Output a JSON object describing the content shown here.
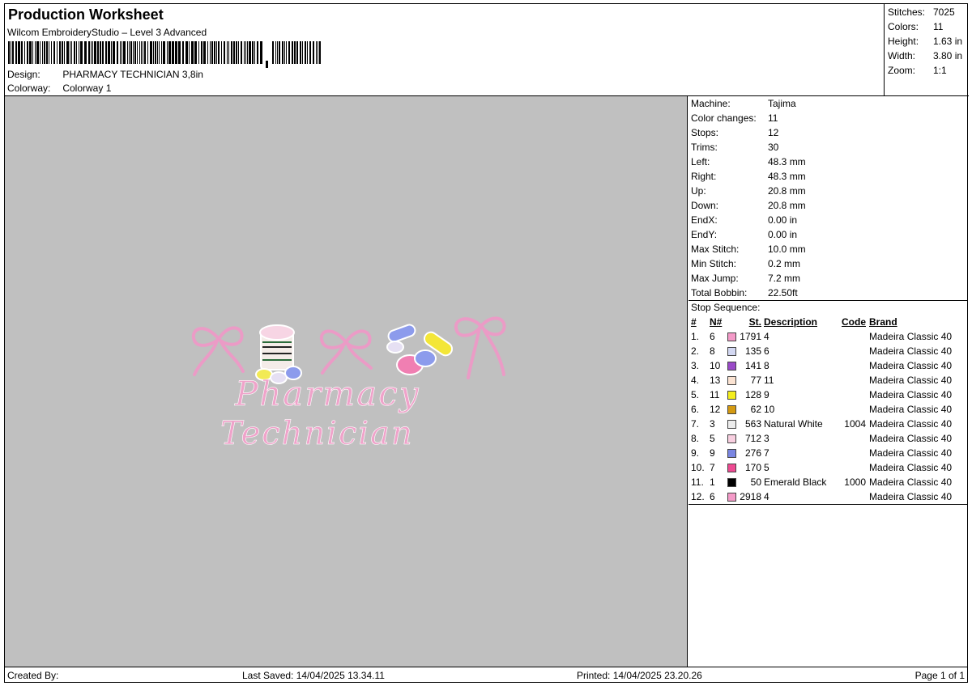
{
  "header": {
    "title": "Production Worksheet",
    "software": "Wilcom EmbroideryStudio – Level 3 Advanced",
    "design_label": "Design:",
    "design_value": "PHARMACY TECHNICIAN 3,8in",
    "colorway_label": "Colorway:",
    "colorway_value": "Colorway 1"
  },
  "stats": [
    {
      "label": "Stitches:",
      "value": "7025"
    },
    {
      "label": "Colors:",
      "value": "11"
    },
    {
      "label": "Height:",
      "value": "1.63 in"
    },
    {
      "label": "Width:",
      "value": "3.80 in"
    },
    {
      "label": "Zoom:",
      "value": "1:1"
    }
  ],
  "specs": [
    {
      "label": "Machine:",
      "value": "Tajima"
    },
    {
      "label": "Color changes:",
      "value": "11"
    },
    {
      "label": "Stops:",
      "value": "12"
    },
    {
      "label": "Trims:",
      "value": "30"
    },
    {
      "label": "Left:",
      "value": "48.3 mm"
    },
    {
      "label": "Right:",
      "value": "48.3 mm"
    },
    {
      "label": "Up:",
      "value": "20.8 mm"
    },
    {
      "label": "Down:",
      "value": "20.8 mm"
    },
    {
      "label": "EndX:",
      "value": "0.00 in"
    },
    {
      "label": "EndY:",
      "value": "0.00 in"
    },
    {
      "label": "Max Stitch:",
      "value": "10.0 mm"
    },
    {
      "label": "Min Stitch:",
      "value": "0.2 mm"
    },
    {
      "label": "Max Jump:",
      "value": "7.2 mm"
    },
    {
      "label": "Total Bobbin:",
      "value": "22.50ft"
    }
  ],
  "stop_sequence": {
    "title": "Stop Sequence:",
    "headers": {
      "idx": "#",
      "n": "N#",
      "st": "St.",
      "desc": "Description",
      "code": "Code",
      "brand": "Brand"
    },
    "rows": [
      {
        "idx": "1.",
        "n": "6",
        "color": "#f49ac8",
        "st": "1791",
        "desc": "4",
        "code": "",
        "brand": "Madeira Classic 40"
      },
      {
        "idx": "2.",
        "n": "8",
        "color": "#d3d8f2",
        "st": "135",
        "desc": "6",
        "code": "",
        "brand": "Madeira Classic 40"
      },
      {
        "idx": "3.",
        "n": "10",
        "color": "#9a4ac8",
        "st": "141",
        "desc": "8",
        "code": "",
        "brand": "Madeira Classic 40"
      },
      {
        "idx": "4.",
        "n": "13",
        "color": "#fbe3d2",
        "st": "77",
        "desc": "11",
        "code": "",
        "brand": "Madeira Classic 40"
      },
      {
        "idx": "5.",
        "n": "11",
        "color": "#f4ee1e",
        "st": "128",
        "desc": "9",
        "code": "",
        "brand": "Madeira Classic 40"
      },
      {
        "idx": "6.",
        "n": "12",
        "color": "#d49a12",
        "st": "62",
        "desc": "10",
        "code": "",
        "brand": "Madeira Classic 40"
      },
      {
        "idx": "7.",
        "n": "3",
        "color": "#ececec",
        "st": "563",
        "desc": "Natural White",
        "code": "1004",
        "brand": "Madeira Classic 40"
      },
      {
        "idx": "8.",
        "n": "5",
        "color": "#f8cfe0",
        "st": "712",
        "desc": "3",
        "code": "",
        "brand": "Madeira Classic 40"
      },
      {
        "idx": "9.",
        "n": "9",
        "color": "#7a86e2",
        "st": "276",
        "desc": "7",
        "code": "",
        "brand": "Madeira Classic 40"
      },
      {
        "idx": "10.",
        "n": "7",
        "color": "#ee4a92",
        "st": "170",
        "desc": "5",
        "code": "",
        "brand": "Madeira Classic 40"
      },
      {
        "idx": "11.",
        "n": "1",
        "color": "#000000",
        "st": "50",
        "desc": "Emerald Black",
        "code": "1000",
        "brand": "Madeira Classic 40"
      },
      {
        "idx": "12.",
        "n": "6",
        "color": "#f49ac8",
        "st": "2918",
        "desc": "4",
        "code": "",
        "brand": "Madeira Classic 40"
      }
    ]
  },
  "design_text": {
    "line1": "Pharmacy",
    "line2": "Technician"
  },
  "footer": {
    "created_by": "Created By:",
    "last_saved": "Last Saved: 14/04/2025 13.34.11",
    "printed": "Printed: 14/04/2025 23.20.26",
    "page": "Page 1 of 1"
  },
  "colors": {
    "preview_bg": "#c0c0c0",
    "thread_pink": "#f0a6cc",
    "thread_dark_pink": "#e27fb2"
  }
}
